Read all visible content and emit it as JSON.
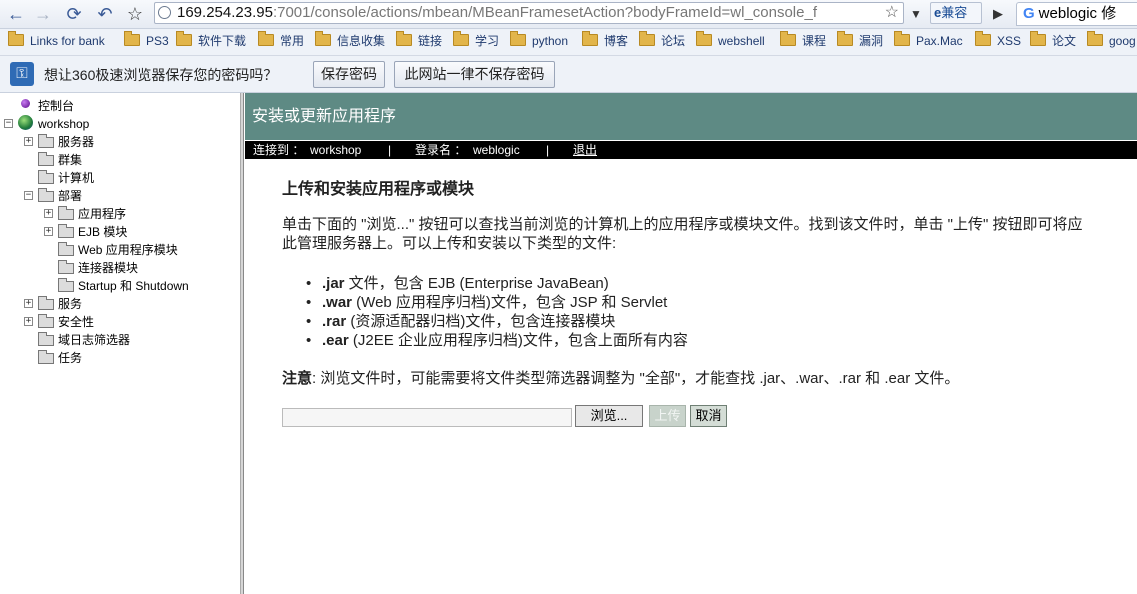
{
  "browser": {
    "url_host": "169.254.23.95",
    "url_path": ":7001/console/actions/mbean/MBeanFramesetAction?bodyFrameId=wl_console_f",
    "compat_label": "兼容",
    "tab_title": "weblogic 修"
  },
  "bookmarks": [
    "Links for bank",
    "PS3",
    "软件下载",
    "常用",
    "信息收集",
    "链接",
    "学习",
    "python",
    "博客",
    "论坛",
    "webshell",
    "课程",
    "漏洞",
    "Pax.Mac",
    "XSS",
    "论文",
    "goog"
  ],
  "password_bar": {
    "message": "想让360极速浏览器保存您的密码吗？",
    "save_label": "保存密码",
    "never_label": "此网站一律不保存密码"
  },
  "tree": {
    "console": "控制台",
    "domain": "workshop",
    "servers": "服务器",
    "clusters": "群集",
    "machines": "计算机",
    "deployments": "部署",
    "applications": "应用程序",
    "ejb_modules": "EJB 模块",
    "web_modules": "Web 应用程序模块",
    "connector_modules": "连接器模块",
    "startup_shutdown": "Startup 和 Shutdown",
    "services": "服务",
    "security": "安全性",
    "domain_log_filters": "域日志筛选器",
    "tasks": "任务"
  },
  "header": {
    "title": "安装或更新应用程序",
    "connected_label": "连接到 ：",
    "connected_value": "workshop",
    "separator": "|",
    "login_label": "登录名 ：",
    "login_value": "weblogic",
    "logout": "退出"
  },
  "content": {
    "heading": "上传和安装应用程序或模块",
    "intro_line1": "单击下面的 \"浏览...\" 按钮可以查找当前浏览的计算机上的应用程序或模块文件。找到该文件时，单击 \"上传\" 按钮即可将应",
    "intro_line2": "此管理服务器上。可以上传和安装以下类型的文件:",
    "items": [
      {
        "ext": ".jar",
        "desc": " 文件，包含  EJB (Enterprise JavaBean)"
      },
      {
        "ext": ".war",
        "desc": " (Web 应用程序归档)文件，包含  JSP 和  Servlet"
      },
      {
        "ext": ".rar",
        "desc": " (资源适配器归档)文件，包含连接器模块"
      },
      {
        "ext": ".ear",
        "desc": " (J2EE 企业应用程序归档)文件，包含上面所有内容"
      }
    ],
    "note_label": "注意",
    "note_text": ": 浏览文件时，可能需要将文件类型筛选器调整为  \"全部\"，才能查找  .jar、.war、.rar 和  .ear 文件。",
    "browse": "浏览...",
    "upload": "上传",
    "cancel": "取消"
  }
}
